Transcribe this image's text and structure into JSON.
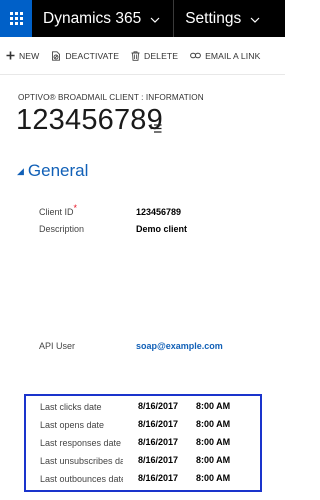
{
  "topnav": {
    "app_name": "Dynamics 365",
    "area_name": "Settings"
  },
  "commands": [
    {
      "label": "NEW",
      "icon": "plus-icon"
    },
    {
      "label": "DEACTIVATE",
      "icon": "deactivate-icon"
    },
    {
      "label": "DELETE",
      "icon": "trash-icon"
    },
    {
      "label": "EMAIL A LINK",
      "icon": "link-icon"
    }
  ],
  "header": {
    "entity_form": "OPTIVO® BROADMAIL CLIENT : INFORMATION",
    "record_title": "123456789"
  },
  "section": {
    "title": "General"
  },
  "fields": {
    "client_id": {
      "label": "Client ID",
      "value": "123456789",
      "required": "*"
    },
    "description": {
      "label": "Description",
      "value": "Demo client"
    },
    "api_user": {
      "label": "API User",
      "value": "soap@example.com"
    }
  },
  "dates": [
    {
      "label": "Last clicks date",
      "date": "8/16/2017",
      "time": "8:00 AM"
    },
    {
      "label": "Last opens date",
      "date": "8/16/2017",
      "time": "8:00 AM"
    },
    {
      "label": "Last responses date",
      "date": "8/16/2017",
      "time": "8:00 AM"
    },
    {
      "label": "Last unsubscribes date",
      "date": "8/16/2017",
      "time": "8:00 AM"
    },
    {
      "label": "Last outbounces date",
      "date": "8/16/2017",
      "time": "8:00 AM"
    }
  ],
  "colors": {
    "accent": "#1160b7",
    "waffle": "#0060c8",
    "highlight_box": "#1a34cc",
    "required": "#e81123"
  }
}
